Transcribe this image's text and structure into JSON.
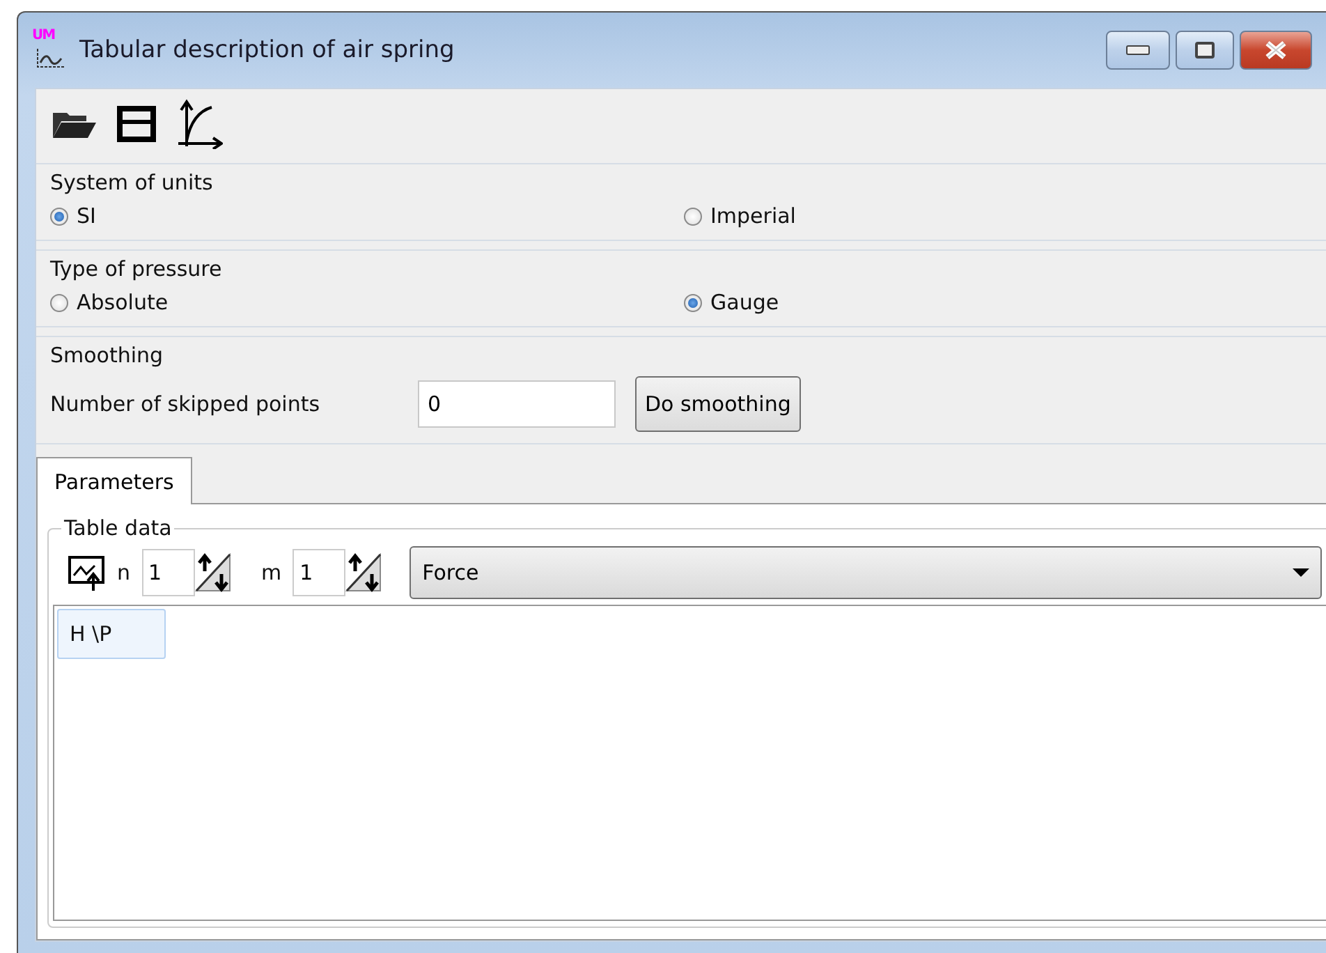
{
  "window": {
    "title": "Tabular description of air spring",
    "app_badge": "UM"
  },
  "units": {
    "title": "System of units",
    "options": [
      {
        "label": "SI",
        "selected": true
      },
      {
        "label": "Imperial",
        "selected": false
      }
    ]
  },
  "pressure": {
    "title": "Type of pressure",
    "options": [
      {
        "label": "Absolute",
        "selected": false
      },
      {
        "label": "Gauge",
        "selected": true
      }
    ]
  },
  "smoothing": {
    "title": "Smoothing",
    "label": "Number of skipped points",
    "value": "0",
    "button": "Do smoothing"
  },
  "tabs": [
    {
      "label": "Parameters",
      "selected": true
    }
  ],
  "table_data": {
    "title": "Table data",
    "n_label": "n",
    "n_value": "1",
    "m_label": "m",
    "m_value": "1",
    "quantity": "Force",
    "corner_cell": "H \\P"
  }
}
